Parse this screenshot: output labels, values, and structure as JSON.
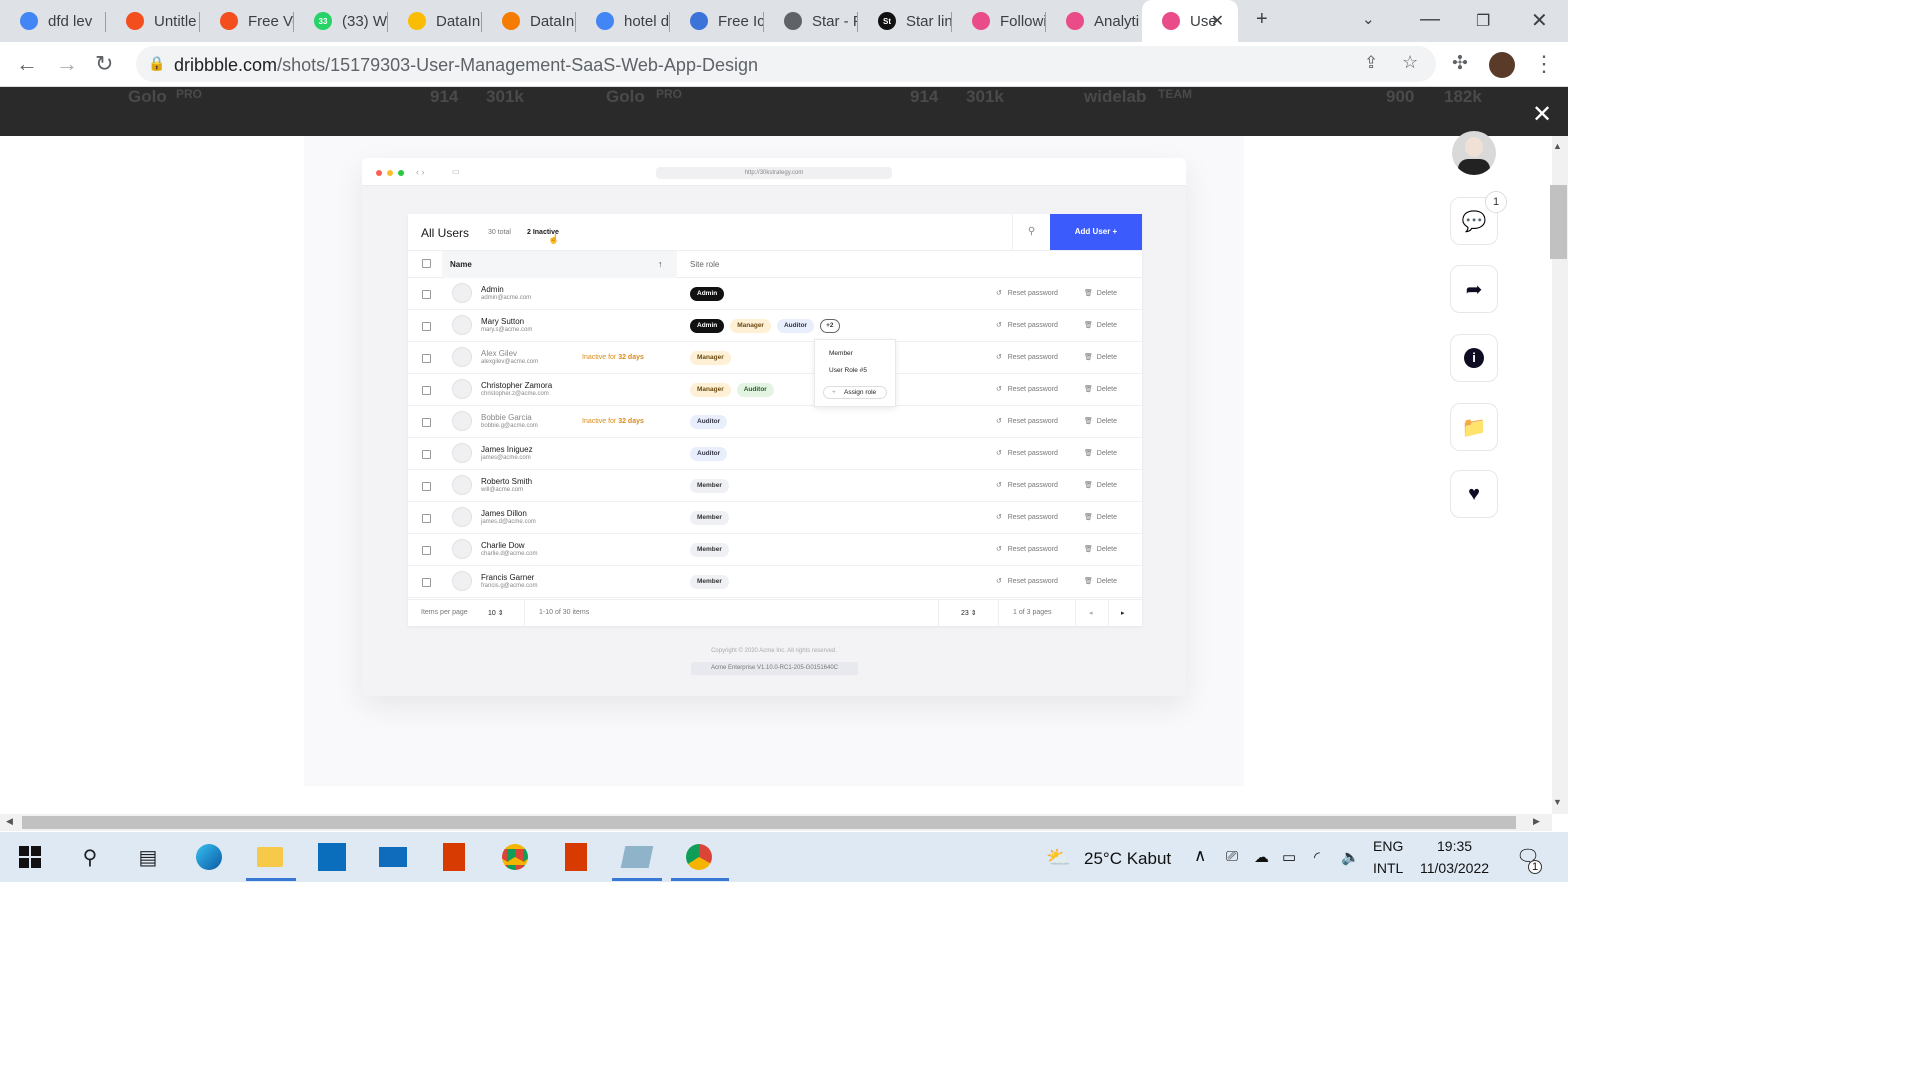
{
  "browser": {
    "tabs": [
      {
        "label": "dfd lev",
        "icon": "google-icon",
        "color": "#4285f4"
      },
      {
        "label": "Untitle",
        "icon": "figma-icon",
        "color": "#f24e1e"
      },
      {
        "label": "Free Ve",
        "icon": "figma-icon",
        "color": "#f24e1e"
      },
      {
        "label": "(33) W",
        "icon": "whatsapp-icon",
        "color": "#25d366",
        "badge": "33"
      },
      {
        "label": "DataIn",
        "icon": "drive-icon",
        "color": "#fbbc04"
      },
      {
        "label": "DataIn",
        "icon": "datainsight-icon",
        "color": "#f57c00"
      },
      {
        "label": "hotel d",
        "icon": "google-icon",
        "color": "#4285f4"
      },
      {
        "label": "Free Ic",
        "icon": "reddit-like-icon",
        "color": "#3b73d9"
      },
      {
        "label": "Star - F",
        "icon": "globe-icon",
        "color": "#5f6368"
      },
      {
        "label": "Star lin",
        "icon": "st-icon",
        "color": "#111111",
        "badge": "St"
      },
      {
        "label": "Followi",
        "icon": "dribbble-icon",
        "color": "#ea4c89"
      },
      {
        "label": "Analyti",
        "icon": "dribbble-icon",
        "color": "#ea4c89"
      },
      {
        "label": "Use",
        "icon": "dribbble-icon",
        "color": "#ea4c89",
        "active": true
      }
    ],
    "new_tab_label": "+",
    "url_host": "dribbble.com",
    "url_path": "/shots/15179303-User-Management-SaaS-Web-App-Design"
  },
  "background_strip": {
    "items": [
      "Golo",
      "PRO",
      "914",
      "301k",
      "Golo",
      "PRO",
      "914",
      "301k",
      "widelab",
      "TEAM",
      "900",
      "182k"
    ]
  },
  "mock": {
    "url": "http://30kstrategy.com",
    "title": "All Users",
    "total": "30 total",
    "inactive": "2 Inactive",
    "add_user": "Add User +",
    "col_name": "Name",
    "col_role": "Site role",
    "reset_label": "Reset password",
    "delete_label": "Delete",
    "users": [
      {
        "name": "Admin",
        "email": "admin@acme.com",
        "roles": [
          "Admin"
        ]
      },
      {
        "name": "Mary Sutton",
        "email": "mary.s@acme.com",
        "roles": [
          "Admin",
          "Manager",
          "Auditor",
          "+2"
        ]
      },
      {
        "name": "Alex Gilev",
        "email": "alexgilev@acme.com",
        "inactive": "Inactive for",
        "days": "32 days",
        "roles": [
          "Manager"
        ]
      },
      {
        "name": "Christopher Zamora",
        "email": "christopher.z@acme.com",
        "roles": [
          "Manager",
          "Auditor"
        ]
      },
      {
        "name": "Bobbie Garcia",
        "email": "bobbie.g@acme.com",
        "inactive": "Inactive for",
        "days": "32 days",
        "roles": [
          "Auditor"
        ]
      },
      {
        "name": "James Iniguez",
        "email": "james@acme.com",
        "roles": [
          "Auditor"
        ]
      },
      {
        "name": "Roberto Smith",
        "email": "will@acme.com",
        "roles": [
          "Member"
        ]
      },
      {
        "name": "James Dillon",
        "email": "james.d@acme.com",
        "roles": [
          "Member"
        ]
      },
      {
        "name": "Charlie Dow",
        "email": "charlie.d@acme.com",
        "roles": [
          "Member"
        ]
      },
      {
        "name": "Francis Garner",
        "email": "francis.g@acme.com",
        "roles": [
          "Member"
        ]
      }
    ],
    "role_menu": {
      "items": [
        "Member",
        "User Role #5"
      ],
      "assign": "Assign role"
    },
    "footer": {
      "items_per_page_label": "Items per page",
      "items_per_page": "10",
      "range": "1-10 of 30 items",
      "page": "23",
      "pages": "1 of 3 pages"
    },
    "copyright": "Copyright © 2020 Acme Inc. All rights reserved.",
    "build": "Acme Enterprise V1.10.0-RC1-205-G0151640C"
  },
  "rail": {
    "comment_count": "1"
  },
  "taskbar": {
    "weather": "25°C  Kabut",
    "lang1": "ENG",
    "lang2": "INTL",
    "time": "19:35",
    "date": "11/03/2022",
    "notif_count": "1"
  },
  "colors": {
    "accent": "#3b5bfd",
    "inactive": "#d98a1d",
    "dribbble": "#ea4c89"
  }
}
